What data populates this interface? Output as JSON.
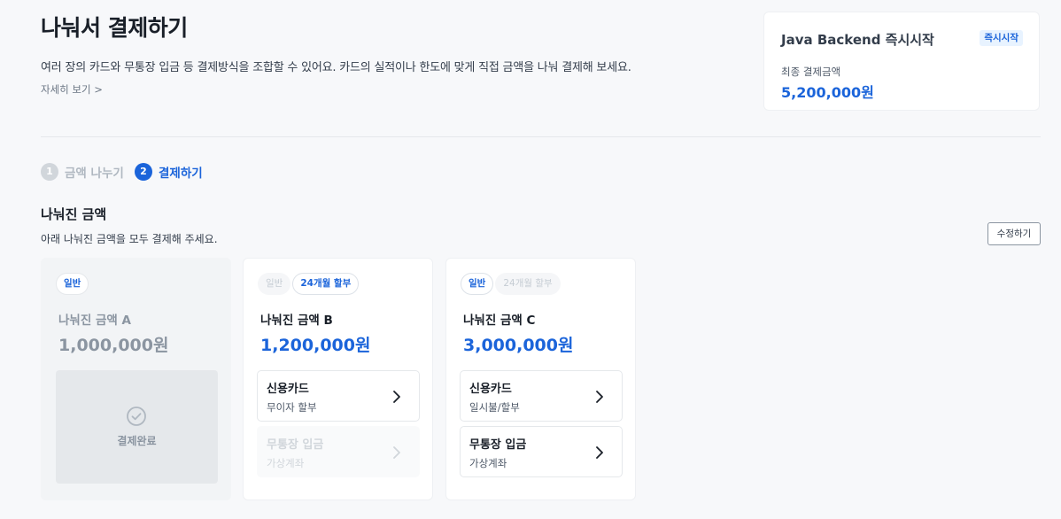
{
  "header": {
    "title": "나눠서 결제하기",
    "description": "여러 장의 카드와 무통장 입금 등 결제방식을 조합할 수 있어요. 카드의 실적이나 한도에 맞게 직접 금액을 나눠 결제해 보세요.",
    "more_link": "자세히 보기 >"
  },
  "summary": {
    "product": "Java Backend 즉시시작",
    "badge": "즉시시작",
    "total_label": "최종 결제금액",
    "total_amount": "5,200,000원"
  },
  "steps": [
    {
      "num": "1",
      "label": "금액 나누기",
      "state": "inactive"
    },
    {
      "num": "2",
      "label": "결제하기",
      "state": "active"
    }
  ],
  "section": {
    "title": "나눠진 금액",
    "description": "아래 나눠진 금액을 모두 결제해 주세요.",
    "edit_button": "수정하기"
  },
  "cards": [
    {
      "chips": [
        "일반"
      ],
      "name": "나눠진 금액 A",
      "amount": "1,000,000원",
      "status": "결제완료"
    },
    {
      "chips": [
        "일반",
        "24개월 할부"
      ],
      "name": "나눠진 금액 B",
      "amount": "1,200,000원",
      "methods": [
        {
          "title": "신용카드",
          "sub": "무이자 할부"
        },
        {
          "title": "무통장 입금",
          "sub": "가상계좌"
        }
      ]
    },
    {
      "chips": [
        "일반",
        "24개월 할부"
      ],
      "name": "나눠진 금액 C",
      "amount": "3,000,000원",
      "methods": [
        {
          "title": "신용카드",
          "sub": "일시불/할부"
        },
        {
          "title": "무통장 입금",
          "sub": "가상계좌"
        }
      ]
    }
  ],
  "colors": {
    "accent": "#1b64da",
    "background": "#f7f8fa",
    "muted": "#8b95a1"
  }
}
